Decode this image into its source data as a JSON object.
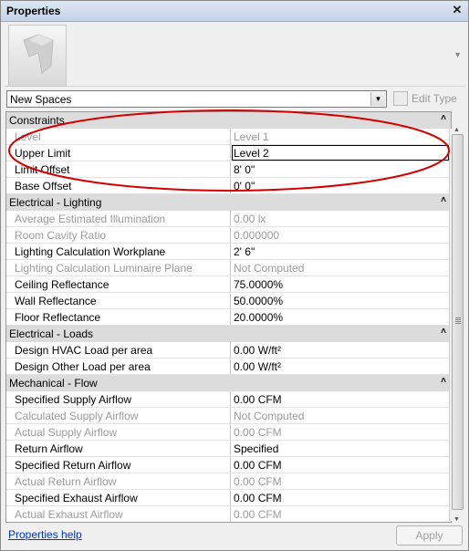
{
  "window": {
    "title": "Properties"
  },
  "type_selector": {
    "value": "New Spaces",
    "edit_type_label": "Edit Type"
  },
  "groups": [
    {
      "title": "Constraints",
      "rows": [
        {
          "name": "Level",
          "value": "Level 1",
          "readonly": true
        },
        {
          "name": "Upper Limit",
          "value": "Level 2",
          "readonly": false,
          "active": true
        },
        {
          "name": "Limit Offset",
          "value": "8'  0\"",
          "readonly": false
        },
        {
          "name": "Base Offset",
          "value": "0'  0\"",
          "readonly": false
        }
      ]
    },
    {
      "title": "Electrical - Lighting",
      "rows": [
        {
          "name": "Average Estimated Illumination",
          "value": "0.00 lx",
          "readonly": true
        },
        {
          "name": "Room Cavity Ratio",
          "value": "0.000000",
          "readonly": true
        },
        {
          "name": "Lighting Calculation Workplane",
          "value": "2'  6\"",
          "readonly": false
        },
        {
          "name": "Lighting Calculation Luminaire Plane",
          "value": "Not Computed",
          "readonly": true
        },
        {
          "name": "Ceiling Reflectance",
          "value": "75.0000%",
          "readonly": false
        },
        {
          "name": "Wall Reflectance",
          "value": "50.0000%",
          "readonly": false
        },
        {
          "name": "Floor Reflectance",
          "value": "20.0000%",
          "readonly": false
        }
      ]
    },
    {
      "title": "Electrical - Loads",
      "rows": [
        {
          "name": "Design HVAC Load per area",
          "value": "0.00 W/ft²",
          "readonly": false
        },
        {
          "name": "Design Other Load per area",
          "value": "0.00 W/ft²",
          "readonly": false
        }
      ]
    },
    {
      "title": "Mechanical - Flow",
      "rows": [
        {
          "name": "Specified Supply Airflow",
          "value": "0.00 CFM",
          "readonly": false
        },
        {
          "name": "Calculated Supply Airflow",
          "value": "Not Computed",
          "readonly": true
        },
        {
          "name": "Actual Supply Airflow",
          "value": "0.00 CFM",
          "readonly": true
        },
        {
          "name": "Return Airflow",
          "value": "Specified",
          "readonly": false
        },
        {
          "name": "Specified Return Airflow",
          "value": "0.00 CFM",
          "readonly": false
        },
        {
          "name": "Actual Return Airflow",
          "value": "0.00 CFM",
          "readonly": true
        },
        {
          "name": "Specified Exhaust Airflow",
          "value": "0.00 CFM",
          "readonly": false
        },
        {
          "name": "Actual Exhaust Airflow",
          "value": "0.00 CFM",
          "readonly": true
        }
      ]
    }
  ],
  "footer": {
    "help_link": "Properties help",
    "apply_label": "Apply"
  },
  "colors": {
    "highlight_ellipse": "#d40000",
    "group_header": "#dcdcdc",
    "link": "#0033cc",
    "readonly_text": "#9b9b9b"
  },
  "icons": {
    "close": "close-icon",
    "collapse": "collapse-chevrons-icon",
    "dropdown": "chevron-down-icon",
    "edit_type": "edit-type-icon"
  }
}
